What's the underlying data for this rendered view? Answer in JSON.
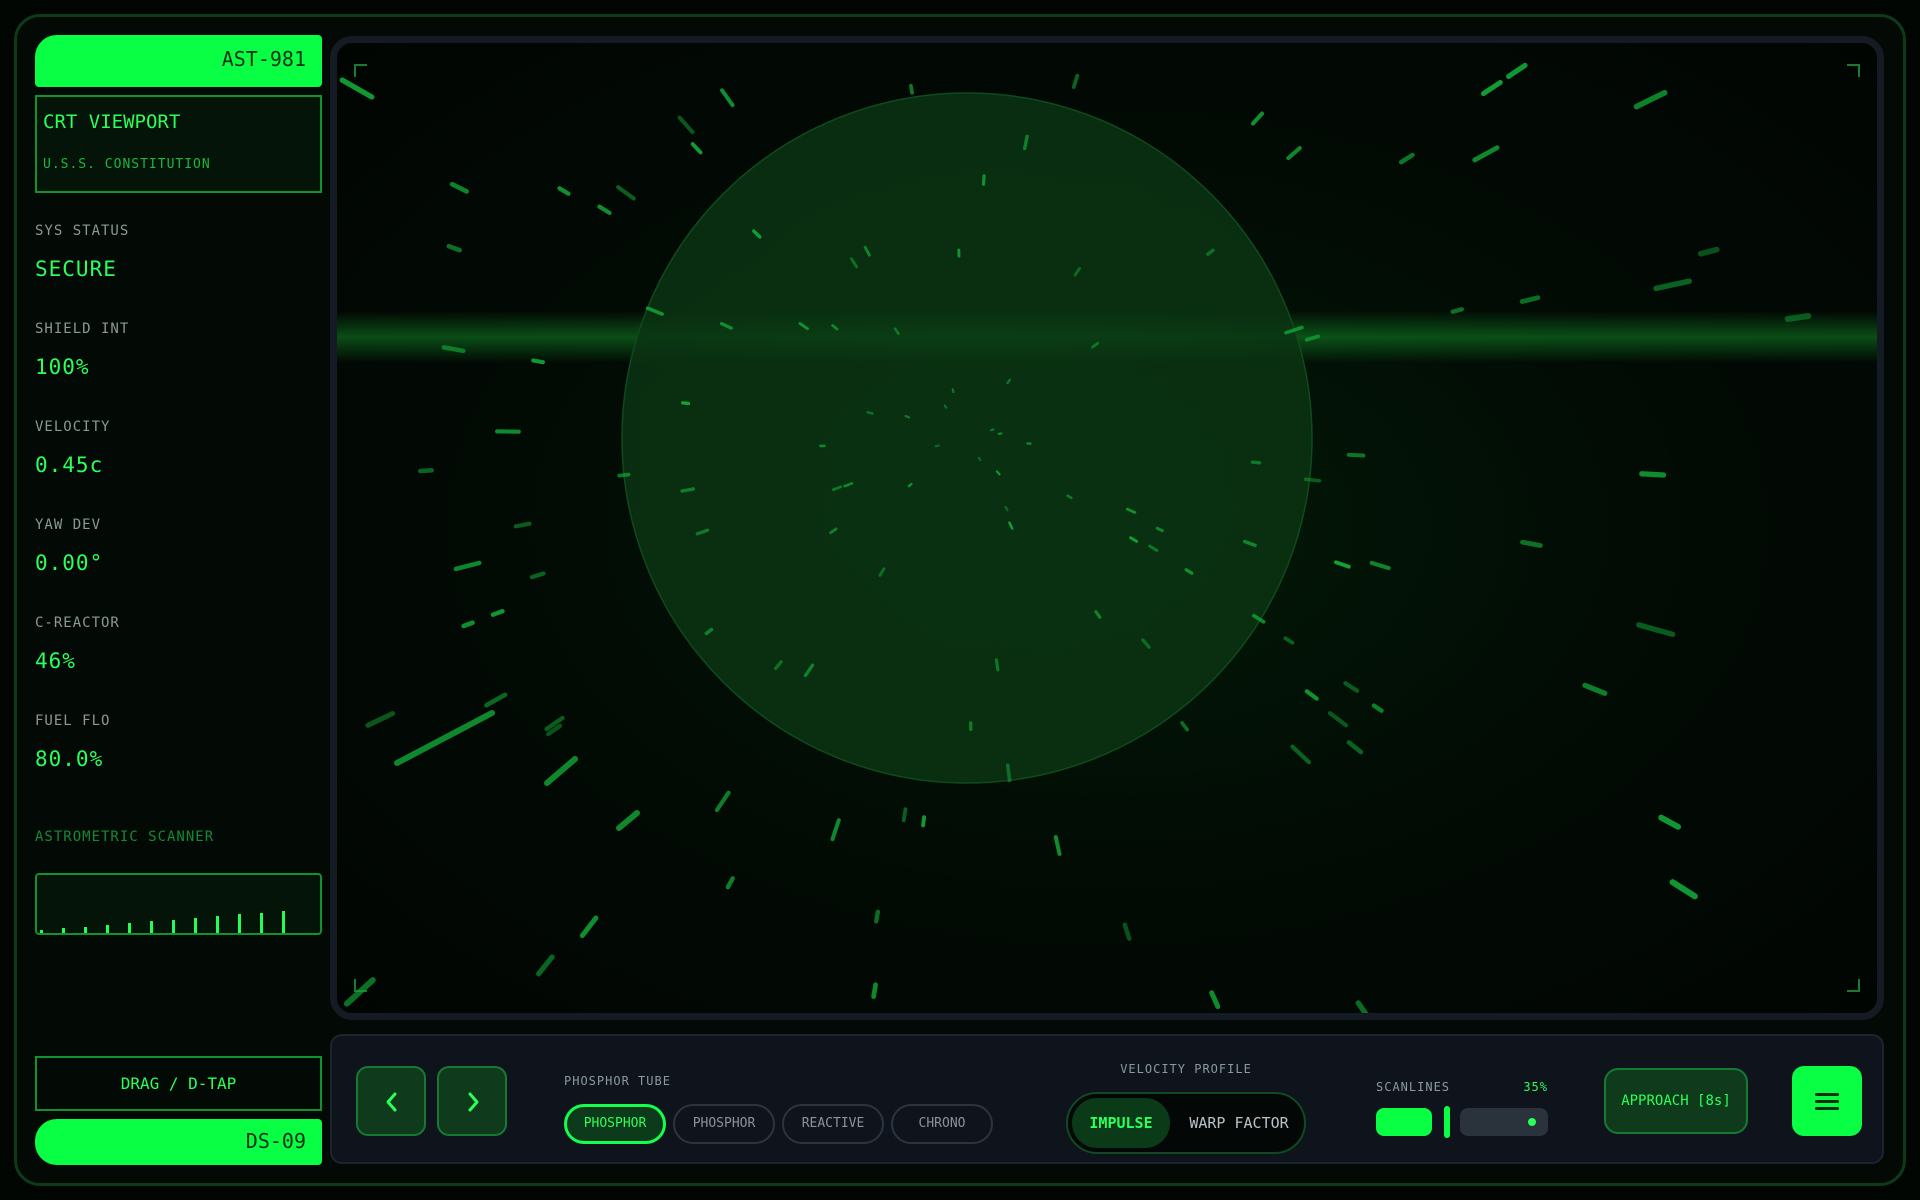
{
  "app": {
    "ship_id": "AST-981",
    "view_title": "CRT VIEWPORT",
    "vessel": "U.S.S. CONSTITUTION",
    "sector": "DS-09"
  },
  "stats": [
    {
      "label": "SYS STATUS",
      "value": "SECURE"
    },
    {
      "label": "SHIELD INT",
      "value": "100%"
    },
    {
      "label": "VELOCITY",
      "value": "0.45c"
    },
    {
      "label": "YAW DEV",
      "value": "0.00°"
    },
    {
      "label": "C-REACTOR",
      "value": "46%"
    },
    {
      "label": "FUEL FLO",
      "value": "80.0%"
    }
  ],
  "scanner": {
    "label": "ASTROMETRIC SCANNER",
    "levels": [
      0.1,
      0.16,
      0.22,
      0.28,
      0.34,
      0.4,
      0.46,
      0.52,
      0.58,
      0.64,
      0.7,
      0.76
    ]
  },
  "drag_hint": "DRAG / D-TAP",
  "controls": {
    "prev_icon": "chevron-left-icon",
    "next_icon": "chevron-right-icon",
    "tube_label": "PHOSPHOR TUBE",
    "tube_options": [
      {
        "label": "PHOSPHOR",
        "active": true
      },
      {
        "label": "PHOSPHOR",
        "active": false
      },
      {
        "label": "REACTIVE",
        "active": false
      },
      {
        "label": "CHRONO",
        "active": false
      }
    ],
    "velocity_label": "VELOCITY PROFILE",
    "velocity_options": [
      "IMPULSE",
      "WARP FACTOR"
    ],
    "velocity_selected": "IMPULSE",
    "scanlines_label": "SCANLINES",
    "scanlines_value": "35%",
    "approach_label": "APPROACH [8s]",
    "menu_icon": "hamburger-menu-icon"
  },
  "colors": {
    "accent": "#08ff44",
    "text": "#2bff5a",
    "dim": "#11922e",
    "panel": "#0e131c"
  }
}
